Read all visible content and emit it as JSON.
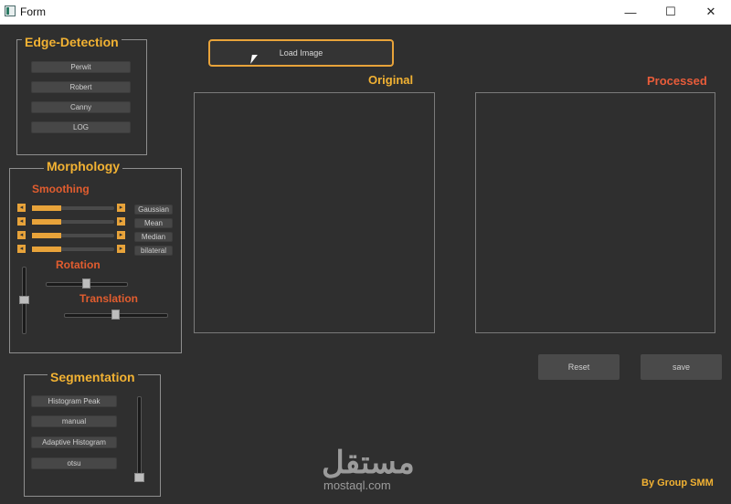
{
  "window": {
    "title": "Form",
    "minimize_glyph": "—",
    "maximize_glyph": "☐",
    "close_glyph": "✕"
  },
  "edge_detection": {
    "title": "Edge-Detection",
    "buttons": [
      "Perwit",
      "Robert",
      "Canny",
      "LOG"
    ]
  },
  "morphology": {
    "title": "Morphology",
    "smoothing_label": "Smoothing",
    "filter_buttons": [
      "Gaussian",
      "Mean",
      "Median",
      "bilateral"
    ],
    "left_arrow": "◂",
    "right_arrow": "▸",
    "rotation_label": "Rotation",
    "translation_label": "Translation",
    "smoothing_slider_values": [
      0.36,
      0.36,
      0.36,
      0.36
    ],
    "rotation_value": 0.5,
    "translation_value": 0.5,
    "vertical_slider_value": 0.5
  },
  "segmentation": {
    "title": "Segmentation",
    "buttons": [
      "Histogram Peak",
      "manual",
      "Adaptive Histogram",
      "otsu"
    ],
    "slider_value": 0.0
  },
  "main": {
    "load_button": "Load Image",
    "original_label": "Original",
    "processed_label": "Processed",
    "reset_button": "Reset",
    "save_button": "save",
    "credit": "By Group SMM"
  },
  "colors": {
    "accent": "#f2b233",
    "processed": "#e85c3a",
    "subheading": "#e25d2f"
  },
  "watermark": {
    "arabic": "مستقل",
    "latin": "mostaql.com"
  }
}
